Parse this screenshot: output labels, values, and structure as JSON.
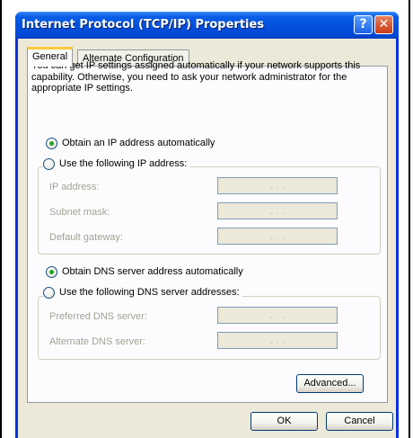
{
  "window": {
    "title": "Internet Protocol (TCP/IP) Properties",
    "help_glyph": "?",
    "close_glyph": "✕"
  },
  "tabs": [
    {
      "label": "General",
      "selected": true
    },
    {
      "label": "Alternate Configuration",
      "selected": false
    }
  ],
  "intro_text": "You can get IP settings assigned automatically if your network supports this capability. Otherwise, you need to ask your network administrator for the appropriate IP settings.",
  "ip_section": {
    "auto_label": "Obtain an IP address automatically",
    "auto_selected": true,
    "manual_label": "Use the following IP address:",
    "fields": [
      {
        "label": "IP address:",
        "value": ". . ."
      },
      {
        "label": "Subnet mask:",
        "value": ". . ."
      },
      {
        "label": "Default gateway:",
        "value": ". . ."
      }
    ]
  },
  "dns_section": {
    "auto_label": "Obtain DNS server address automatically",
    "auto_selected": true,
    "manual_label": "Use the following DNS server addresses:",
    "fields": [
      {
        "label": "Preferred DNS server:",
        "value": ". . ."
      },
      {
        "label": "Alternate DNS server:",
        "value": ". . ."
      }
    ]
  },
  "buttons": {
    "advanced": "Advanced...",
    "ok": "OK",
    "cancel": "Cancel"
  },
  "colors": {
    "title_bar": "#0a5ee6",
    "dialog_face": "#ece9d8",
    "radio_selected": "#21a121",
    "active_tab_accent": "#ffc83c"
  }
}
